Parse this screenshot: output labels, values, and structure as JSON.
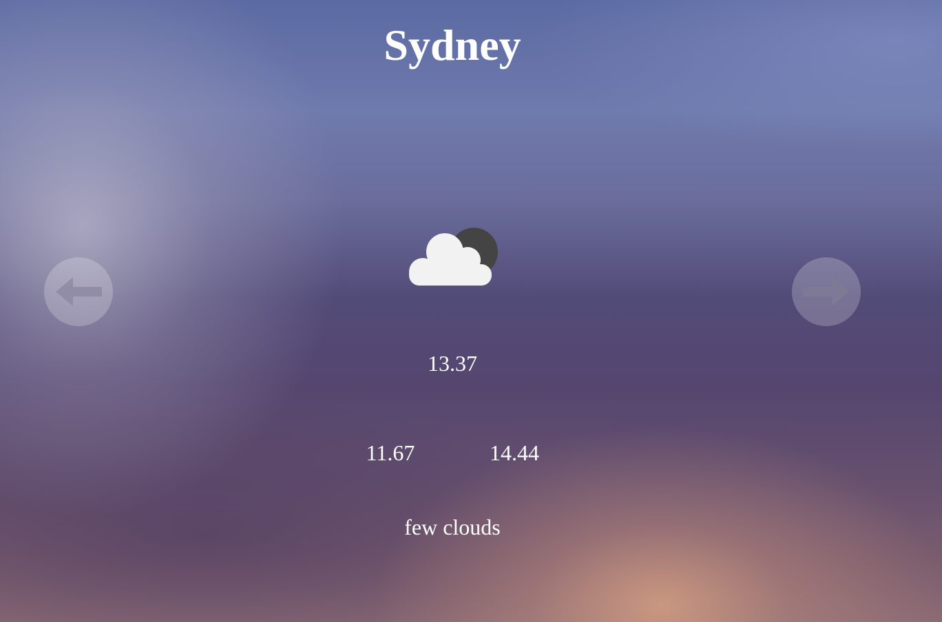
{
  "city": "Sydney",
  "weather": {
    "icon": "few-clouds-night-icon",
    "temperature": "13.37",
    "temp_min": "11.67",
    "temp_max": "14.44",
    "description": "few clouds"
  },
  "navigation": {
    "prev_icon": "arrow-left-icon",
    "next_icon": "arrow-right-icon"
  },
  "colors": {
    "text": "#ffffff",
    "nav_button_bg": "rgba(255,255,255,0.22)",
    "nav_arrow": "#7e7a95",
    "cloud": "#f2f2f2",
    "moon": "#444444"
  }
}
